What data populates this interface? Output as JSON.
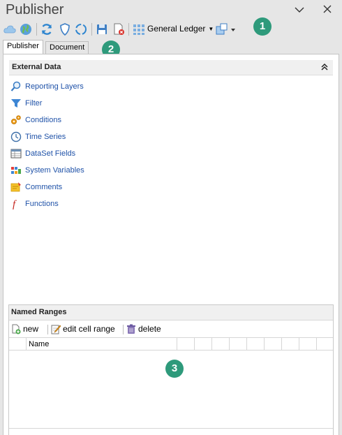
{
  "window": {
    "title": "Publisher"
  },
  "toolbar": {
    "ledger_dropdown": "General Ledger"
  },
  "tabs": [
    {
      "label": "Publisher"
    },
    {
      "label": "Document"
    }
  ],
  "external_data": {
    "header": "External Data",
    "items": [
      {
        "label": "Reporting Layers",
        "icon": "magnifier-icon"
      },
      {
        "label": "Filter",
        "icon": "funnel-icon"
      },
      {
        "label": "Conditions",
        "icon": "gears-icon"
      },
      {
        "label": "Time Series",
        "icon": "clock-icon"
      },
      {
        "label": "DataSet Fields",
        "icon": "dataset-table-icon"
      },
      {
        "label": "System Variables",
        "icon": "variables-icon"
      },
      {
        "label": "Comments",
        "icon": "note-icon"
      },
      {
        "label": "Functions",
        "icon": "function-icon"
      }
    ]
  },
  "named_ranges": {
    "header": "Named Ranges",
    "actions": {
      "new": "new",
      "edit": "edit cell range",
      "delete": "delete"
    },
    "columns": [
      "Name"
    ]
  },
  "callouts": [
    "1",
    "2",
    "3"
  ],
  "colors": {
    "callout": "#2e9a7b",
    "link": "#1f52a8"
  }
}
